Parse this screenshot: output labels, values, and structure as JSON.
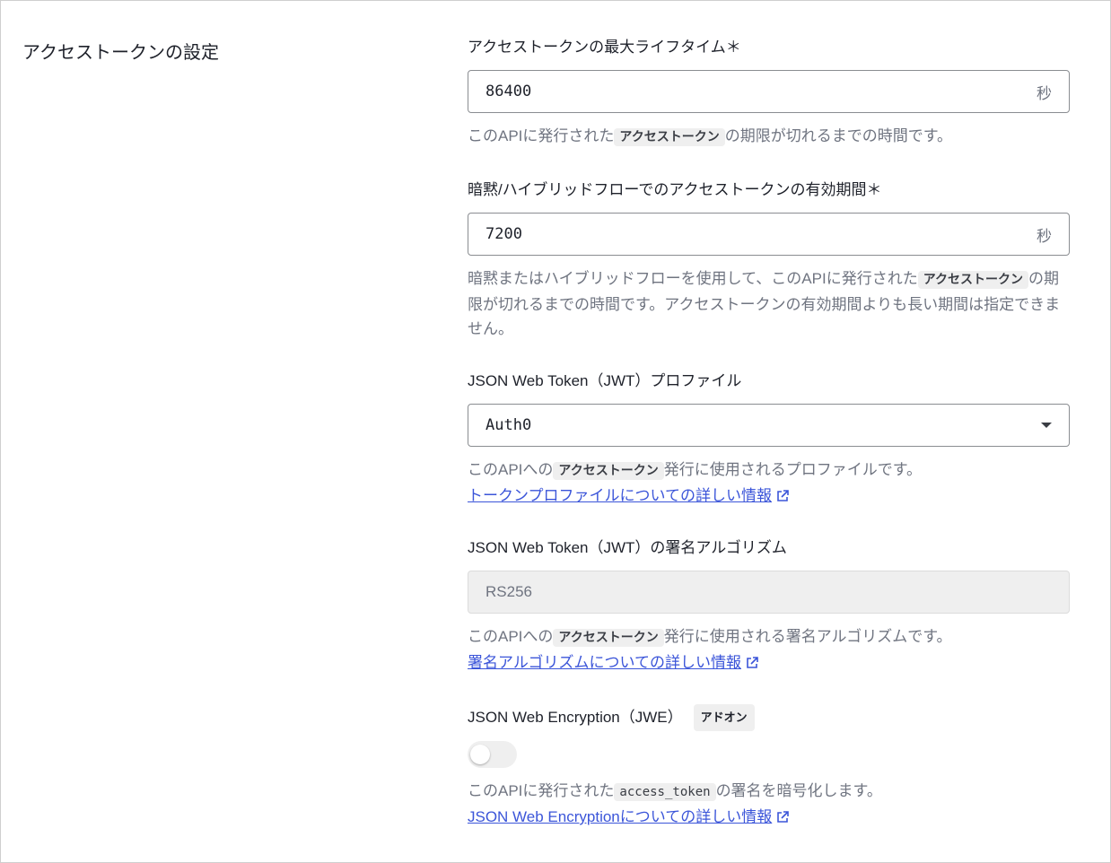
{
  "section": {
    "title": "アクセストークンの設定"
  },
  "max_lifetime": {
    "label": "アクセストークンの最大ライフタイム＊",
    "value": "86400",
    "unit": "秒",
    "help_before": "このAPIに発行された",
    "help_code": "アクセストークン",
    "help_after": "の期限が切れるまでの時間です。"
  },
  "implicit_lifetime": {
    "label": "暗黙/ハイブリッドフローでのアクセストークンの有効期間＊",
    "value": "7200",
    "unit": "秒",
    "help_before": "暗黙またはハイブリッドフローを使用して、このAPIに発行された",
    "help_code": "アクセストークン",
    "help_after": "の期限が切れるまでの時間です。アクセストークンの有効期間よりも長い期間は指定できません。"
  },
  "jwt_profile": {
    "label": "JSON Web Token（JWT）プロファイル",
    "selected": "Auth0",
    "help_before": "このAPIへの",
    "help_code": "アクセストークン",
    "help_after": "発行に使用されるプロファイルです。",
    "link": "トークンプロファイルについての詳しい情報"
  },
  "jwt_algorithm": {
    "label": "JSON Web Token（JWT）の署名アルゴリズム",
    "value": "RS256",
    "help_before": "このAPIへの",
    "help_code": "アクセストークン",
    "help_after": "発行に使用される署名アルゴリズムです。",
    "link": "署名アルゴリズムについての詳しい情報"
  },
  "jwe": {
    "label": "JSON Web Encryption（JWE）",
    "badge": "アドオン",
    "enabled": false,
    "help_before": "このAPIに発行された",
    "help_code": "access_token",
    "help_after": "の署名を暗号化します。",
    "link": "JSON Web Encryptionについての詳しい情報"
  },
  "colors": {
    "link": "#3b55d9",
    "muted": "#6f7480",
    "text": "#1e212a"
  }
}
